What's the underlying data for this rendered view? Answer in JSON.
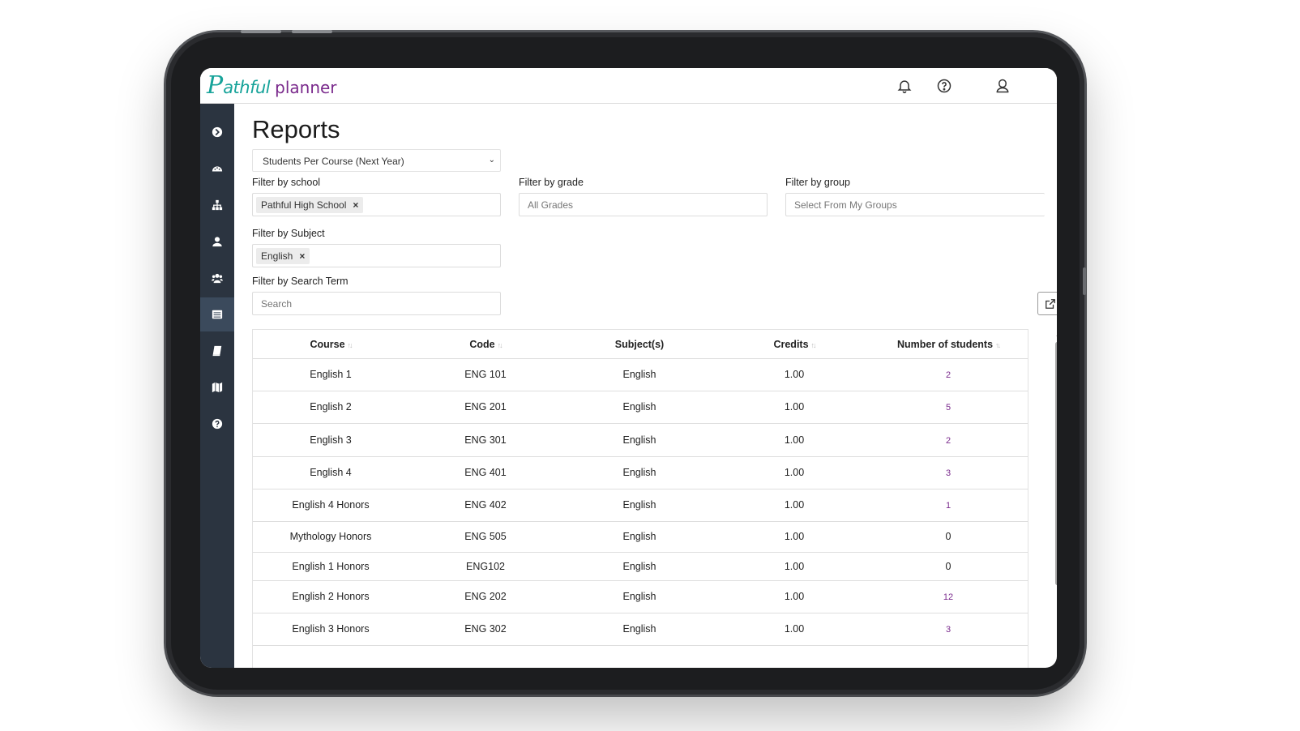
{
  "brand": {
    "logo_p": "P",
    "logo_rest": "athful",
    "logo_planner": "planner",
    "primary_color": "#17a39a",
    "secondary_color": "#7a2a8c"
  },
  "topbar": {
    "icons": [
      "bell-icon",
      "help-icon",
      "user-icon"
    ]
  },
  "sidebar": {
    "items": [
      {
        "icon": "arrow-right-circle-icon",
        "active": false
      },
      {
        "icon": "dashboard-gauge-icon",
        "active": false
      },
      {
        "icon": "sitemap-icon",
        "active": false
      },
      {
        "icon": "user-icon",
        "active": false
      },
      {
        "icon": "users-icon",
        "active": false
      },
      {
        "icon": "reports-table-icon",
        "active": true
      },
      {
        "icon": "book-icon",
        "active": false
      },
      {
        "icon": "map-icon",
        "active": false
      },
      {
        "icon": "question-circle-icon",
        "active": false
      }
    ]
  },
  "page": {
    "title": "Reports",
    "report_select": "Students Per Course (Next Year)"
  },
  "filters": {
    "school_label": "Filter by school",
    "school_chip": "Pathful High School",
    "grade_label": "Filter by grade",
    "grade_placeholder": "All Grades",
    "group_label": "Filter by group",
    "group_placeholder": "Select From My Groups",
    "subject_label": "Filter by Subject",
    "subject_chip": "English",
    "search_label": "Filter by Search Term",
    "search_placeholder": "Search",
    "chip_remove": "×"
  },
  "table": {
    "headers": {
      "course": "Course",
      "code": "Code",
      "subjects": "Subject(s)",
      "credits": "Credits",
      "students": "Number of students"
    },
    "rows": [
      {
        "course": "English 1",
        "code": "ENG 101",
        "subject": "English",
        "credits": "1.00",
        "students": "2"
      },
      {
        "course": "English 2",
        "code": "ENG 201",
        "subject": "English",
        "credits": "1.00",
        "students": "5"
      },
      {
        "course": "English 3",
        "code": "ENG 301",
        "subject": "English",
        "credits": "1.00",
        "students": "2"
      },
      {
        "course": "English 4",
        "code": "ENG 401",
        "subject": "English",
        "credits": "1.00",
        "students": "3"
      },
      {
        "course": "English 4 Honors",
        "code": "ENG 402",
        "subject": "English",
        "credits": "1.00",
        "students": "1"
      },
      {
        "course": "Mythology Honors",
        "code": "ENG 505",
        "subject": "English",
        "credits": "1.00",
        "students": "0"
      },
      {
        "course": "English 1 Honors",
        "code": "ENG102",
        "subject": "English",
        "credits": "1.00",
        "students": "0"
      },
      {
        "course": "English 2 Honors",
        "code": "ENG 202",
        "subject": "English",
        "credits": "1.00",
        "students": "12"
      },
      {
        "course": "English 3 Honors",
        "code": "ENG 302",
        "subject": "English",
        "credits": "1.00",
        "students": "3"
      }
    ]
  }
}
